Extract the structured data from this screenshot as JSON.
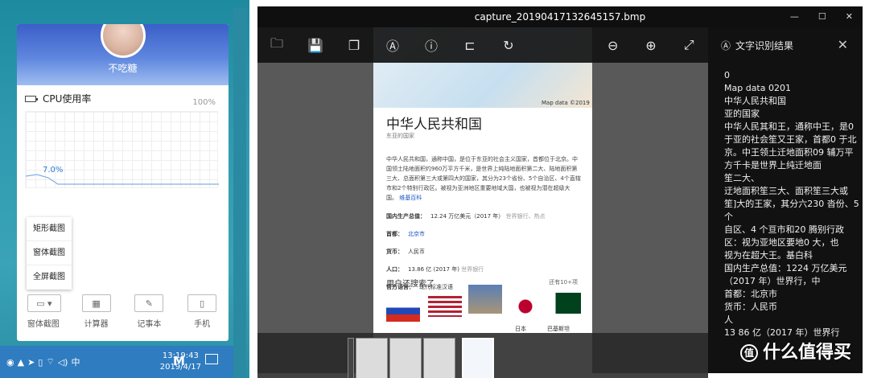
{
  "desktop": {
    "username": "不吃糖",
    "cpu_label": "CPU使用率",
    "cpu_max": "100%",
    "cpu_current": "7.0%",
    "menu_items": [
      "矩形截图",
      "窗体截图",
      "全屏截图"
    ],
    "tools": [
      {
        "label": "窗体截图",
        "icon": "window-capture-icon"
      },
      {
        "label": "计算器",
        "icon": "calculator-icon"
      },
      {
        "label": "记事本",
        "icon": "notepad-icon"
      },
      {
        "label": "手机",
        "icon": "phone-icon"
      }
    ],
    "taskbar": {
      "ime": "中",
      "time": "13:19:43",
      "date": "2019/4/17",
      "logo": "M"
    }
  },
  "viewer": {
    "title": "capture_20190417132645157.bmp",
    "toolbar_icons": [
      "folder-icon",
      "save-icon",
      "copy-icon",
      "ocr-icon",
      "info-icon",
      "crop-icon",
      "rotate-icon",
      "zoom-out-icon",
      "zoom-in-icon",
      "fit-icon"
    ],
    "doc": {
      "map_credit": "Map data ©2019",
      "title": "中华人民共和国",
      "subtitle": "东亚的国家",
      "body": "中华人民共和国，通称中国，是位于东亚的社会主义国家，首都位于北京。中国领土陆地面积约960万平方千米，是世界上纯陆地面积第二大、陆地面积第三大、总面积第三大或第四大的国家，其分为23个省份、5个自治区、4个直辖市和2个特别行政区。被视为亚洲地区重要地域大国，也被视为潜在超级大国。",
      "body_link": "维基百科",
      "facts": [
        {
          "k": "国内生产总值：",
          "v": "12.24 万亿美元（2017 年）",
          "note": "世界银行、热点"
        },
        {
          "k": "首都：",
          "v": "北京市",
          "note": ""
        },
        {
          "k": "货币：",
          "v": "人民币",
          "note": ""
        },
        {
          "k": "人口：",
          "v": "13.86 亿 (2017 年)",
          "note": "世界银行"
        },
        {
          "k": "官方语言：",
          "v": "现代标准汉语",
          "note": ""
        }
      ],
      "related_title": "用户还搜索了",
      "related_more": "还有10+项",
      "related_labels": [
        "日本",
        "巴基斯坦"
      ]
    },
    "ocr": {
      "title": "文字识别结果",
      "text": "0\nMap data 0201\n中华人民共和国\n亚的国家\n中华人民其和王，通称中王，是0 于亚的社会笙又王家，首都0 于北\n京。中王领土迁地面积09 辅万平方千卡是世界上纯迁地面\n笙二大、\n迂地面积笙三大、面积笙三大或笙]大的王家，其分六230 沓份、5 个\n自区、4 个亘市和20 腾别行政区：视为亚地区要地0 大，也\n视为在超大王。基白科\n国内生产总值：1224 万亿美元（2017 年）世界行，中\n首都：北京市\n货币：人民币\n人\n13 86 亿（2017 年）世界行"
    }
  },
  "watermark": "什么值得买"
}
